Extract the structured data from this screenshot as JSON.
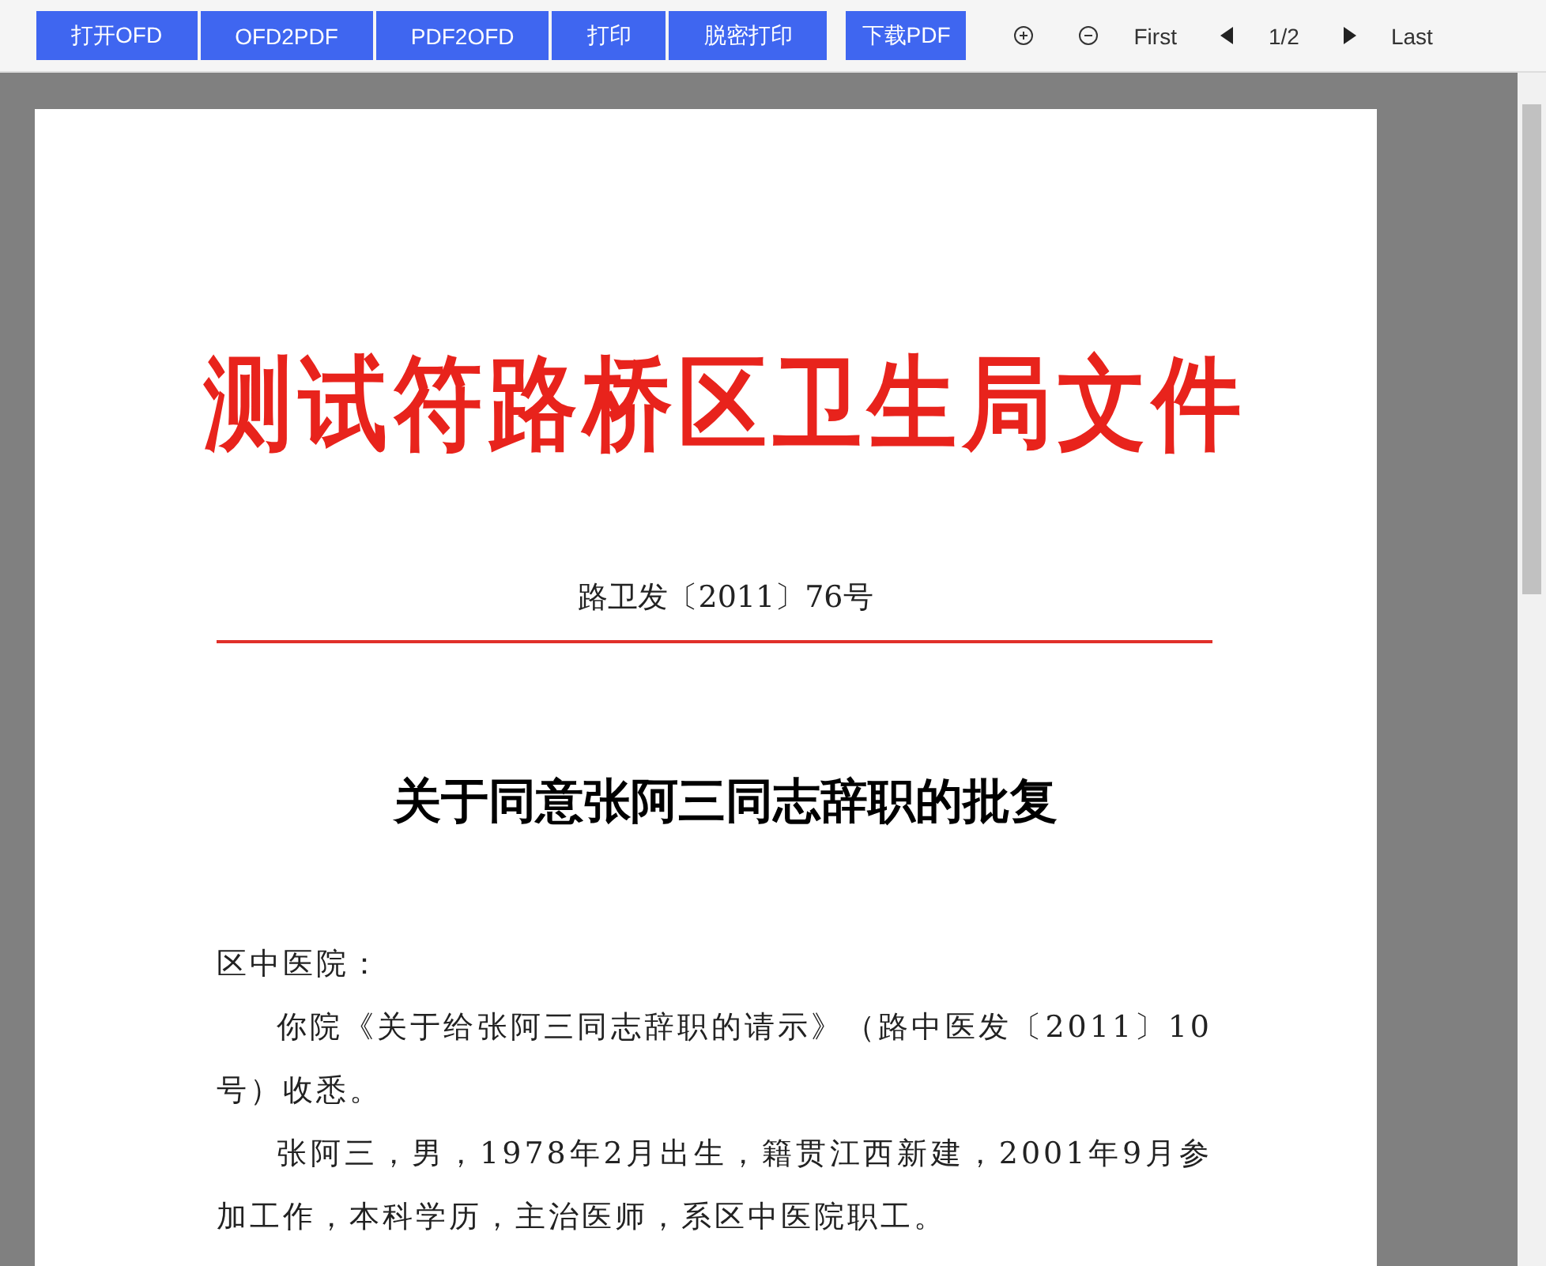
{
  "toolbar": {
    "buttons": [
      {
        "label": "打开OFD"
      },
      {
        "label": "OFD2PDF"
      },
      {
        "label": "PDF2OFD"
      },
      {
        "label": "打印"
      },
      {
        "label": "脱密打印"
      },
      {
        "label": "下载PDF"
      }
    ],
    "first": "First",
    "page_indicator": "1/2",
    "last": "Last"
  },
  "document": {
    "header_title": "测试符路桥区卫生局文件",
    "doc_number": "路卫发〔2011〕76号",
    "heading": "关于同意张阿三同志辞职的批复",
    "paragraphs": [
      {
        "kind": "salutation",
        "text": "区中医院："
      },
      {
        "kind": "body",
        "text": "你院《关于给张阿三同志辞职的请示》（路中医发〔2011〕10号）收悉。"
      },
      {
        "kind": "body",
        "text": "张阿三，男，1978年2月出生，籍贯江西新建，2001年9月参加工作，本科学历，主治医师，系区中医院职工。"
      }
    ]
  }
}
